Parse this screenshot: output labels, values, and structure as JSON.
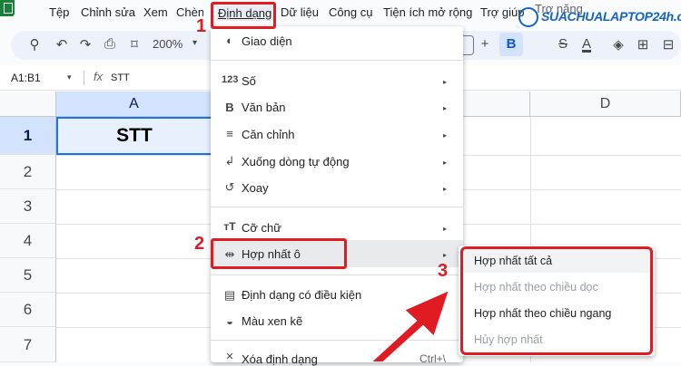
{
  "menubar": {
    "items": [
      "Tệp",
      "Chỉnh sửa",
      "Xem",
      "Chèn",
      "Định dạng",
      "Dữ liệu",
      "Công cụ",
      "Tiện ích mở rộng",
      "Trợ giúp",
      "Trợ năng"
    ]
  },
  "toolbar": {
    "zoom": "200%",
    "zoom_arrow": "▾",
    "search_icon": "⚲",
    "undo_icon": "↶",
    "redo_icon": "↷",
    "print_icon": "⎙",
    "paint_format_icon": "⌑",
    "bold": "B",
    "strike": "S",
    "text_color": "A",
    "plus": "+",
    "fill_icon": "◈",
    "borders_icon": "⊞",
    "merge_icon": "⊟"
  },
  "formula_bar": {
    "name_box": "A1:B1",
    "name_arrow": "▾",
    "fx": "fx",
    "value": "STT"
  },
  "grid": {
    "columns": [
      "A",
      "D"
    ],
    "rows": [
      "1",
      "2",
      "3",
      "4",
      "5",
      "6",
      "7"
    ],
    "cell_a1": "STT"
  },
  "format_menu": {
    "items": [
      {
        "icon": "◐",
        "label": "Giao diện"
      },
      {
        "icon": "123",
        "label": "Số"
      },
      {
        "icon": "B",
        "label": "Văn bản"
      },
      {
        "icon": "≡",
        "label": "Căn chỉnh"
      },
      {
        "icon": "↲",
        "label": "Xuống dòng tự động"
      },
      {
        "icon": "↺",
        "label": "Xoay"
      },
      {
        "icon": "тT",
        "label": "Cỡ chữ"
      },
      {
        "icon": "⇹",
        "label": "Hợp nhất ô"
      },
      {
        "icon": "▤",
        "label": "Định dạng có điều kiện"
      },
      {
        "icon": "◒",
        "label": "Màu xen kẽ"
      },
      {
        "icon": "✕",
        "label": "Xóa định dạng"
      }
    ],
    "arrow": "▸",
    "shortcut": "Ctrl+\\"
  },
  "merge_submenu": {
    "items": [
      {
        "label": "Hợp nhất tất cả",
        "disabled": false
      },
      {
        "label": "Hợp nhất theo chiều dọc",
        "disabled": true
      },
      {
        "label": "Hợp nhất theo chiều ngang",
        "disabled": false
      },
      {
        "label": "Hủy hợp nhất",
        "disabled": true
      }
    ]
  },
  "annotations": {
    "step1": "1",
    "step2": "2",
    "step3": "3"
  },
  "watermark": {
    "text": "SUACHUALAPTOP24h.com"
  },
  "colors": {
    "accent_red": "#e11b22",
    "sheets_green": "#188038",
    "selection_blue": "#d3e3fd",
    "watermark_blue": "#1565c0"
  }
}
